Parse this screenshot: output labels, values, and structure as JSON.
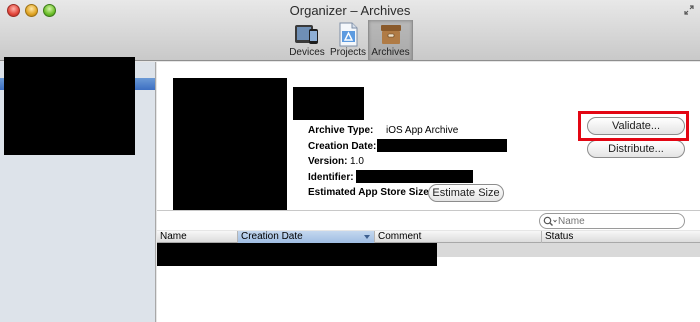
{
  "window": {
    "title": "Organizer – Archives"
  },
  "toolbar": {
    "devices_label": "Devices",
    "projects_label": "Projects",
    "archives_label": "Archives"
  },
  "archive": {
    "type_label": "Archive Type:",
    "type_value": "iOS App Archive",
    "creation_date_label": "Creation Date:",
    "version_label": "Version:",
    "version_value": "1.0",
    "identifier_label": "Identifier:",
    "size_label": "Estimated App Store Size:",
    "estimate_size_button": "Estimate Size",
    "validate_button": "Validate...",
    "distribute_button": "Distribute..."
  },
  "search": {
    "placeholder": "Name"
  },
  "table": {
    "columns": [
      "Name",
      "Creation Date",
      "Comment",
      "Status"
    ],
    "sorted_column": "Creation Date"
  },
  "colors": {
    "highlight": "#e30613",
    "selection": "#3d6fc2",
    "sidebar_bg": "#dde3ea"
  }
}
